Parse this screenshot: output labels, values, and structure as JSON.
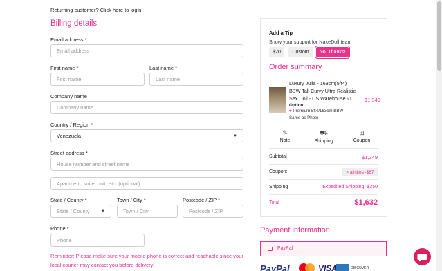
{
  "returning": {
    "prefix": "Returning customer?",
    "link": "Click here to login"
  },
  "billing": {
    "title": "Billing details",
    "email_label": "Email address *",
    "email_placeholder": "Email address",
    "first_label": "First name *",
    "first_placeholder": "First name",
    "last_label": "Last name *",
    "last_placeholder": "Last name",
    "company_label": "Company name",
    "company_placeholder": "Company name",
    "country_label": "Country / Region *",
    "country_value": "Venezuela",
    "street_label": "Street address *",
    "street_placeholder": "House number and street name",
    "apt_placeholder": "Apartment, suite, unit, etc. (optional)",
    "state_label": "State / County *",
    "state_placeholder": "State / County",
    "town_label": "Town / City *",
    "town_placeholder": "Town / City",
    "postcode_label": "Postcode / ZIP *",
    "postcode_placeholder": "Postcode / ZIP",
    "phone_label": "Phone *",
    "phone_placeholder": "Phone",
    "reminder_line1": "Reminder: Please make sure your mobile phone is correct and reachable since your",
    "reminder_line2": "local courier may contact you before delivery."
  },
  "tip": {
    "title": "Add a Tip",
    "subtitle": "Show your support for NakeDoll team",
    "options": [
      "$20",
      "Custom",
      "No, Thanks!"
    ]
  },
  "order": {
    "title": "Order summary",
    "product_line1": "Luxury Julia - 163cm(5ft4)",
    "product_line2": "BBW Tall Curvy Ultra Realistic",
    "product_line3": "Sex Doll - US Warehouse",
    "qty": "x1",
    "price": "$1,349",
    "option_label": "Option:",
    "option_line1": "Premium 5ft4/163cm BBW -",
    "option_line2": "Same as Photo",
    "actions": [
      "Note",
      "Shipping",
      "Coupon"
    ],
    "subtotal_label": "Subtotal",
    "subtotal_value": "$1,349",
    "coupon_label": "Coupon:",
    "coupon_value": "× allsites -$67",
    "shipping_label": "Shipping",
    "shipping_value": "Expedited Shipping: $350",
    "total_label": "Total",
    "total_value": "$1,632"
  },
  "payment": {
    "title": "Payment information",
    "method": "PayPal",
    "logo_text": "PayPal",
    "visa": "VISA",
    "discover": "DISCOVER"
  },
  "colors": {
    "accent": "#e8338d",
    "chat": "#d8205a"
  }
}
